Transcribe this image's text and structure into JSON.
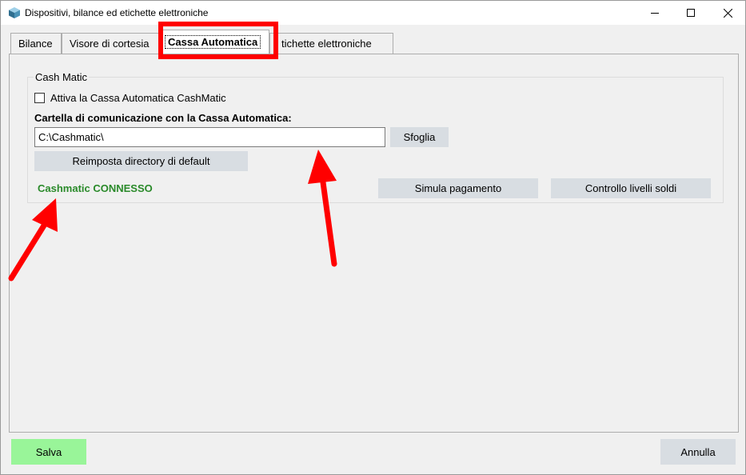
{
  "window": {
    "title": "Dispositivi, bilance ed etichette elettroniche",
    "icon": "cube-app-icon"
  },
  "tabs": [
    {
      "label": "Bilance",
      "selected": false
    },
    {
      "label": "Visore di cortesia",
      "selected": false
    },
    {
      "label": "Cassa Automatica",
      "selected": true
    },
    {
      "label": "tichette elettroniche",
      "selected": false
    }
  ],
  "group": {
    "legend": "Cash Matic",
    "checkbox_label": "Attiva la Cassa Automatica CashMatic",
    "checkbox_checked": false,
    "folder_label": "Cartella di comunicazione con la Cassa Automatica:",
    "folder_value": "C:\\Cashmatic\\",
    "browse_label": "Sfoglia",
    "reset_label": "Reimposta directory di default",
    "status_text": "Cashmatic CONNESSO",
    "status_color": "#2a8a2a",
    "simulate_label": "Simula pagamento",
    "levels_label": "Controllo livelli soldi"
  },
  "footer": {
    "save_label": "Salva",
    "save_color": "#99f599",
    "cancel_label": "Annulla"
  },
  "annotations": {
    "highlight_color": "#ff0000",
    "arrow_color": "#ff0000"
  }
}
